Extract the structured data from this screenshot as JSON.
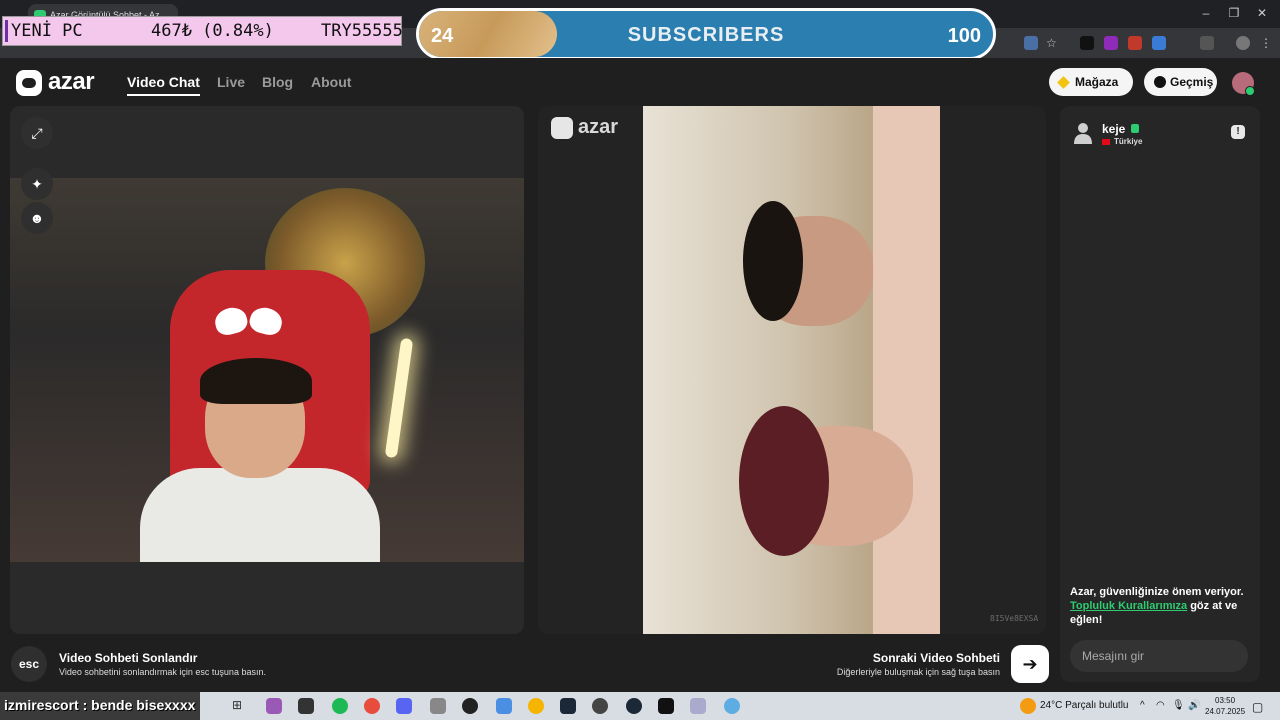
{
  "browser": {
    "tab_title": "Azar Görüntülü Sohbet - Az..."
  },
  "overlay": {
    "ticker": {
      "label": "YENİ PC",
      "value": "467₺ (0.84%)",
      "code": "TRY55555"
    },
    "subscribers": {
      "current": "24",
      "label": "SUBSCRIBERS",
      "goal": "100",
      "progress": 0.24
    }
  },
  "header": {
    "logo": "azar",
    "nav": [
      {
        "label": "Video Chat",
        "active": true
      },
      {
        "label": "Live",
        "active": false
      },
      {
        "label": "Blog",
        "active": false
      },
      {
        "label": "About",
        "active": false
      }
    ],
    "store_label": "Mağaza",
    "history_label": "Geçmiş"
  },
  "remote": {
    "watermark": "azar",
    "code": "8I5Ve8EXSA"
  },
  "chat": {
    "user_name": "keje",
    "country": "Türkiye",
    "safety_text_1": "Azar, güvenliğinize önem veriyor.",
    "safety_link": "Topluluk Kurallarımıza",
    "safety_text_2": " göz at ve eğlen!",
    "input_placeholder": "Mesajını gir"
  },
  "controls": {
    "esc_key": "esc",
    "end_title": "Video Sohbeti Sonlandır",
    "end_sub": "Video sohbetini sonlandırmak için esc tuşuna basın.",
    "next_title": "Sonraki Video Sohbeti",
    "next_sub": "Diğerleriyle buluşmak için sağ tuşa basın"
  },
  "taskbar": {
    "chat_overlay": "izmirescort : bende bisexxxx",
    "weather": "24°C  Parçalı bulutlu",
    "time": "03:50",
    "date": "24.07.2025"
  },
  "colors": {
    "accent": "#2ecc71",
    "background": "#1f1f1f",
    "panel": "#2a2a2a",
    "subs_bar": "#2a7fb0",
    "ticker_bg": "#f3c8ec"
  }
}
